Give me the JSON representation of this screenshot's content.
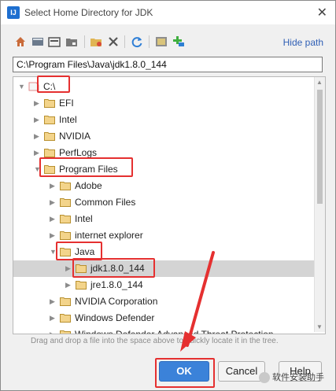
{
  "window": {
    "title": "Select Home Directory for JDK",
    "app_icon": "IJ",
    "close_icon": "close-icon"
  },
  "toolbar": {
    "icons": [
      "home-icon",
      "desktop-icon",
      "project-icon",
      "module-icon",
      "new-folder-icon",
      "delete-icon",
      "refresh-icon",
      "show-hidden-icon",
      "add-icon"
    ],
    "hide_path_label": "Hide path"
  },
  "path": {
    "value": "C:\\Program Files\\Java\\jdk1.8.0_144"
  },
  "tree": {
    "rows": [
      {
        "label": "C:\\",
        "depth": 0,
        "state": "expanded",
        "kind": "drive",
        "selected": false
      },
      {
        "label": "EFI",
        "depth": 1,
        "state": "collapsed",
        "kind": "folder",
        "selected": false
      },
      {
        "label": "Intel",
        "depth": 1,
        "state": "collapsed",
        "kind": "folder",
        "selected": false
      },
      {
        "label": "NVIDIA",
        "depth": 1,
        "state": "collapsed",
        "kind": "folder",
        "selected": false
      },
      {
        "label": "PerfLogs",
        "depth": 1,
        "state": "collapsed",
        "kind": "folder",
        "selected": false
      },
      {
        "label": "Program Files",
        "depth": 1,
        "state": "expanded",
        "kind": "folder",
        "selected": false
      },
      {
        "label": "Adobe",
        "depth": 2,
        "state": "collapsed",
        "kind": "folder",
        "selected": false
      },
      {
        "label": "Common Files",
        "depth": 2,
        "state": "collapsed",
        "kind": "folder",
        "selected": false
      },
      {
        "label": "Intel",
        "depth": 2,
        "state": "collapsed",
        "kind": "folder",
        "selected": false
      },
      {
        "label": "internet explorer",
        "depth": 2,
        "state": "collapsed",
        "kind": "folder",
        "selected": false
      },
      {
        "label": "Java",
        "depth": 2,
        "state": "expanded",
        "kind": "folder",
        "selected": false
      },
      {
        "label": "jdk1.8.0_144",
        "depth": 3,
        "state": "collapsed",
        "kind": "folder",
        "selected": true
      },
      {
        "label": "jre1.8.0_144",
        "depth": 3,
        "state": "collapsed",
        "kind": "folder",
        "selected": false
      },
      {
        "label": "NVIDIA Corporation",
        "depth": 2,
        "state": "collapsed",
        "kind": "folder",
        "selected": false
      },
      {
        "label": "Windows Defender",
        "depth": 2,
        "state": "collapsed",
        "kind": "folder",
        "selected": false
      },
      {
        "label": "Windows Defender Advanced Threat Protection",
        "depth": 2,
        "state": "collapsed",
        "kind": "folder",
        "selected": false
      }
    ]
  },
  "hint": "Drag and drop a file into the space above to quickly locate it in the tree.",
  "buttons": {
    "ok": "OK",
    "cancel": "Cancel",
    "help": "Help"
  },
  "watermark": "软件安装助手",
  "colors": {
    "accent": "#3b82d9",
    "annotation_red": "#e53030",
    "folder": "#e0b554"
  }
}
